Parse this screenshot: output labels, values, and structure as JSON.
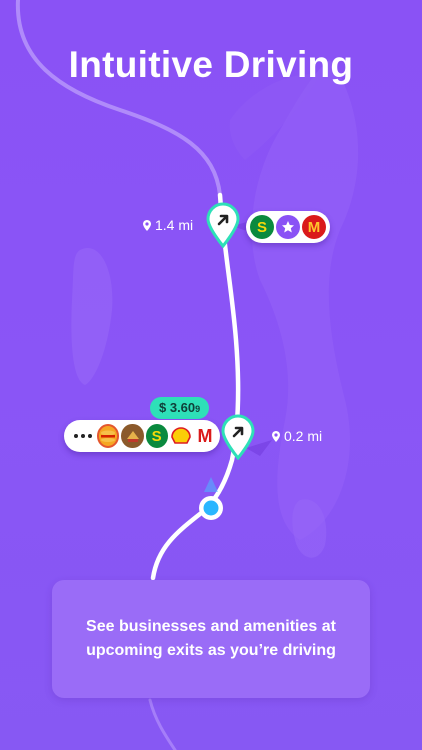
{
  "title": "Intuitive Driving",
  "exits": [
    {
      "distance": "1.4 mi",
      "amenities": [
        "subway-logo",
        "star-icon",
        "mcdonalds-logo"
      ]
    },
    {
      "distance": "0.2 mi",
      "price": "$ 3.60",
      "price_fraction": "9",
      "amenities": [
        "more-dots-icon",
        "burger-king-logo",
        "restaurant-logo",
        "subway-logo",
        "shell-logo",
        "mcdonalds-logo"
      ]
    }
  ],
  "info_text": "See businesses and amenities at upcoming exits as you’re driving",
  "colors": {
    "background": "#8a52f5",
    "route": "#ffffff",
    "pin": "#2ee0b8",
    "price_badge": "#2ee0b8",
    "current_location": "#29b6ff"
  }
}
